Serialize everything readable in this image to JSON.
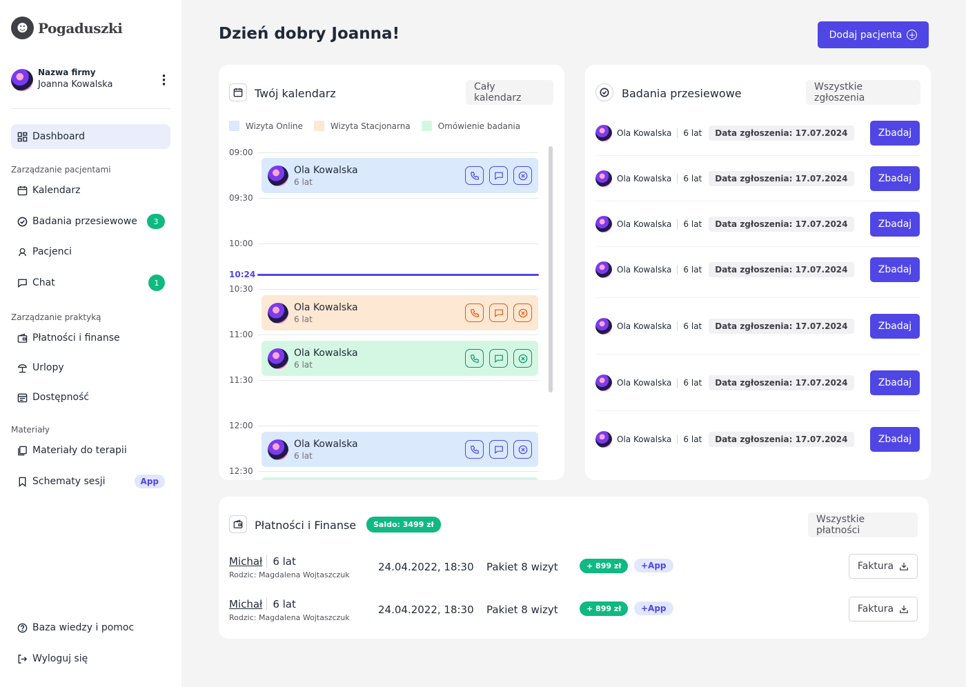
{
  "sidebar": {
    "logo": "Pogaduszki",
    "company": "Nazwa firmy",
    "user": "Joanna Kowalska",
    "dashboard": "Dashboard",
    "section_patients": "Zarządzanie pacjentami",
    "calendar": "Kalendarz",
    "screening": "Badania przesiewowe",
    "screening_count": "3",
    "patients": "Pacjenci",
    "chat": "Chat",
    "chat_count": "1",
    "section_practice": "Zarządzanie praktyką",
    "payments": "Płatności i finanse",
    "vacations": "Urlopy",
    "availability": "Dostępność",
    "section_materials": "Materiały",
    "therapy_materials": "Materiały do terapii",
    "session_schemes": "Schematy sesji",
    "app_badge": "App",
    "help": "Baza wiedzy i pomoc",
    "logout": "Wyloguj się"
  },
  "header": {
    "greeting": "Dzień dobry Joanna!",
    "add_patient": "Dodaj pacjenta"
  },
  "calendar": {
    "title": "Twój kalendarz",
    "all_button": "Cały kalendarz",
    "legend": [
      "Wizyta Online",
      "Wizyta Stacjonarna",
      "Omówienie badania"
    ],
    "times": [
      "09:00",
      "09:30",
      "10:00",
      "10:30",
      "11:00",
      "11:30",
      "12:00",
      "12:30"
    ],
    "now": "10:24",
    "appointments": [
      {
        "name": "Ola Kowalska",
        "age": "6 lat"
      },
      {
        "name": "Ola Kowalska",
        "age": "6 lat"
      },
      {
        "name": "Ola Kowalska",
        "age": "6 lat"
      },
      {
        "name": "Ola Kowalska",
        "age": "6 lat"
      }
    ]
  },
  "screening": {
    "title": "Badania przesiewowe",
    "all_button": "Wszystkie zgłoszenia",
    "action": "Zbadaj",
    "rows": [
      {
        "name": "Ola Kowalska",
        "age": "6 lat",
        "date": "Data zgłoszenia: 17.07.2024"
      },
      {
        "name": "Ola Kowalska",
        "age": "6 lat",
        "date": "Data zgłoszenia: 17.07.2024"
      },
      {
        "name": "Ola Kowalska",
        "age": "6 lat",
        "date": "Data zgłoszenia: 17.07.2024"
      },
      {
        "name": "Ola Kowalska",
        "age": "6 lat",
        "date": "Data zgłoszenia: 17.07.2024"
      },
      {
        "name": "Ola Kowalska",
        "age": "6 lat",
        "date": "Data zgłoszenia: 17.07.2024"
      },
      {
        "name": "Ola Kowalska",
        "age": "6 lat",
        "date": "Data zgłoszenia: 17.07.2024"
      },
      {
        "name": "Ola Kowalska",
        "age": "6 lat",
        "date": "Data zgłoszenia: 17.07.2024"
      }
    ]
  },
  "payments": {
    "title": "Płatności i Finanse",
    "balance": "Saldo: 3499 zł",
    "all_button": "Wszystkie płatności",
    "invoice": "Faktura",
    "rows": [
      {
        "child": "Michał",
        "age": "6 lat",
        "parent": "Rodzic: Magdalena Wojtaszczuk",
        "date": "24.04.2022, 18:30",
        "package": "Pakiet 8 wizyt",
        "amount": "+ 899 zł",
        "source": "+App"
      },
      {
        "child": "Michał",
        "age": "6 lat",
        "parent": "Rodzic: Magdalena Wojtaszczuk",
        "date": "24.04.2022, 18:30",
        "package": "Pakiet 8 wizyt",
        "amount": "+ 899 zł",
        "source": "+App"
      }
    ]
  },
  "colors": {
    "accent": "#4f46e5",
    "success": "#10b981",
    "online": "#dbe9fd",
    "onsite": "#fde8d3",
    "review": "#d4f7e3"
  }
}
